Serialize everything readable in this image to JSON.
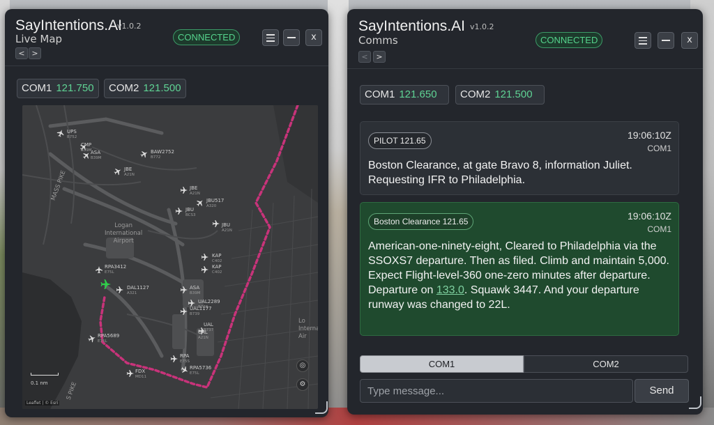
{
  "map_window": {
    "title": "SayIntentions.AI",
    "version": "v1.0.2",
    "subtitle": "Live Map",
    "nav_back": "<",
    "nav_forward": ">",
    "status": "CONNECTED",
    "close_label": "x",
    "com1": {
      "label": "COM1",
      "freq": "121.750"
    },
    "com2": {
      "label": "COM2",
      "freq": "121.500"
    },
    "map": {
      "airport_label": "Logan\nInternational\nAirport",
      "edge_label": "Lo\nInterna\nAir",
      "highway_label": "MASS PIKE",
      "highway_label_2": "S PIKE",
      "scale": "0.1 nm",
      "attribution": "Leaflet | © Esri",
      "aircraft": [
        {
          "callsign": "UPS",
          "type": "B752"
        },
        {
          "callsign": "CMP",
          "type": "B39M"
        },
        {
          "callsign": "ASA",
          "type": "B39M"
        },
        {
          "callsign": "BAW2752",
          "type": "B772"
        },
        {
          "callsign": "JBE",
          "type": "A21N"
        },
        {
          "callsign": "JBE",
          "type": "A21N"
        },
        {
          "callsign": "JBU517",
          "type": "A320"
        },
        {
          "callsign": "JBU",
          "type": "BCS3"
        },
        {
          "callsign": "JBU",
          "type": "A21N"
        },
        {
          "callsign": "KAP",
          "type": "C402"
        },
        {
          "callsign": "KAP",
          "type": "C402"
        },
        {
          "callsign": "RPA3412",
          "type": "E75L"
        },
        {
          "callsign": "DAL1127",
          "type": "A321"
        },
        {
          "callsign": "ASA",
          "type": "B39M"
        },
        {
          "callsign": "UAL2289",
          "type": "B738"
        },
        {
          "callsign": "UAL1177",
          "type": "B739"
        },
        {
          "callsign": "UAL",
          "type": "B737"
        },
        {
          "callsign": "UAL",
          "type": "A21N"
        },
        {
          "callsign": "RPA5689",
          "type": "E75L"
        },
        {
          "callsign": "RPA",
          "type": "E75S"
        },
        {
          "callsign": "RPA5736",
          "type": "E75L"
        },
        {
          "callsign": "FDX",
          "type": "MD11"
        }
      ]
    }
  },
  "comms_window": {
    "title": "SayIntentions.AI",
    "version": "v1.0.2",
    "subtitle": "Comms",
    "nav_back": "<",
    "nav_forward": ">",
    "status": "CONNECTED",
    "close_label": "x",
    "com1": {
      "label": "COM1",
      "freq": "121.650"
    },
    "com2": {
      "label": "COM2",
      "freq": "121.500"
    },
    "messages": [
      {
        "tag": "PILOT 121.65",
        "time": "19:06:10Z",
        "channel": "COM1",
        "text": "Boston Clearance, at gate Bravo 8, information Juliet. Requesting IFR to Philadelphia."
      },
      {
        "tag": "Boston Clearance 121.65",
        "time": "19:06:10Z",
        "channel": "COM1",
        "text_before": "American-one-ninety-eight, Cleared to Philadelphia via the SSOXS7 departure. Then as filed. Climb and maintain 5,000. Expect Flight-level-360 one-zero minutes after departure. Departure on ",
        "link": "133.0",
        "text_after": ". Squawk 3447. And your departure runway was changed to 22L."
      }
    ],
    "tabs": {
      "com1": "COM1",
      "com2": "COM2"
    },
    "input_placeholder": "Type message...",
    "send_label": "Send"
  },
  "colors": {
    "panel": "#23262c",
    "accent_green": "#5fd394",
    "route": "#c8337a",
    "own_aircraft": "#2fd04a"
  }
}
